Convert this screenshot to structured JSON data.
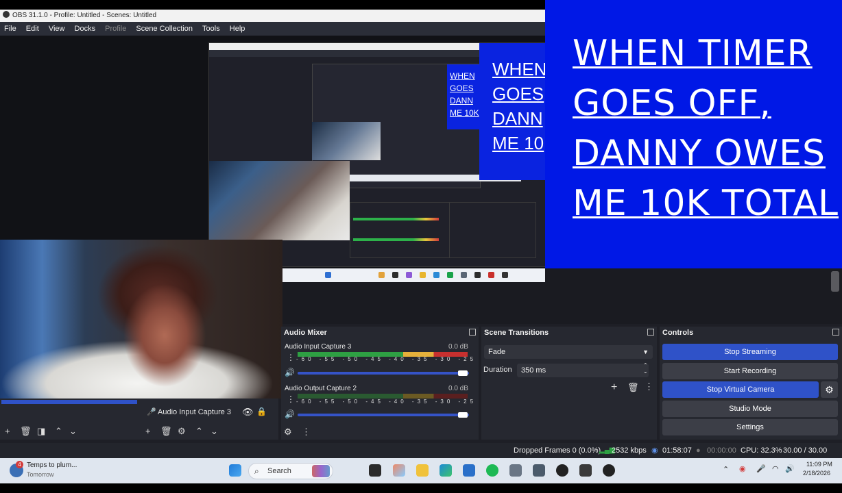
{
  "window": {
    "title": "OBS 31.1.0 - Profile: Untitled - Scenes: Untitled"
  },
  "menu": [
    "File",
    "Edit",
    "View",
    "Docks",
    "Profile",
    "Scene Collection",
    "Tools",
    "Help"
  ],
  "banner": {
    "text": "WHEN TIMER\nGOES OFF,\nDANNY OWES\nME 10K TOTAL",
    "bg": "#0018e6"
  },
  "nested_banner": {
    "text": "WHEN\nGOES\nDANN\nME 10"
  },
  "nested_banner2": {
    "text": "WHEN\nGOES\nDANN\nME 10K"
  },
  "sources": {
    "item_label": "Audio Input Capture 3"
  },
  "mixer": {
    "title": "Audio Mixer",
    "channels": [
      {
        "name": "Audio Input Capture 3",
        "db": "0.0 dB",
        "level": 0.85
      },
      {
        "name": "Audio Output Capture 2",
        "db": "0.0 dB",
        "level": 0.9
      }
    ],
    "scale": "-60 -55 -50 -45 -40 -35 -30 -25 -20 -15 -10 -5 0"
  },
  "transitions": {
    "title": "Scene Transitions",
    "selected": "Fade",
    "duration_label": "Duration",
    "duration_value": "350 ms"
  },
  "controls": {
    "title": "Controls",
    "buttons": [
      "Stop Streaming",
      "Start Recording",
      "Stop Virtual Camera",
      "Studio Mode",
      "Settings"
    ]
  },
  "status": {
    "dropped": "Dropped Frames 0 (0.0%)",
    "kbps": "2532 kbps",
    "stream_time": "01:58:07",
    "rec_time": "00:00:00",
    "cpu": "CPU: 32.3%",
    "fps": "30.00 / 30.00 FPS"
  },
  "taskbar": {
    "weather_title": "Temps to plum...",
    "weather_sub": "Tomorrow",
    "badge": "4",
    "search": "Search",
    "time": "11:09 PM",
    "date": "2/18/2026"
  },
  "colors": {
    "accent": "#2f52c8",
    "banner": "#0018e6"
  }
}
